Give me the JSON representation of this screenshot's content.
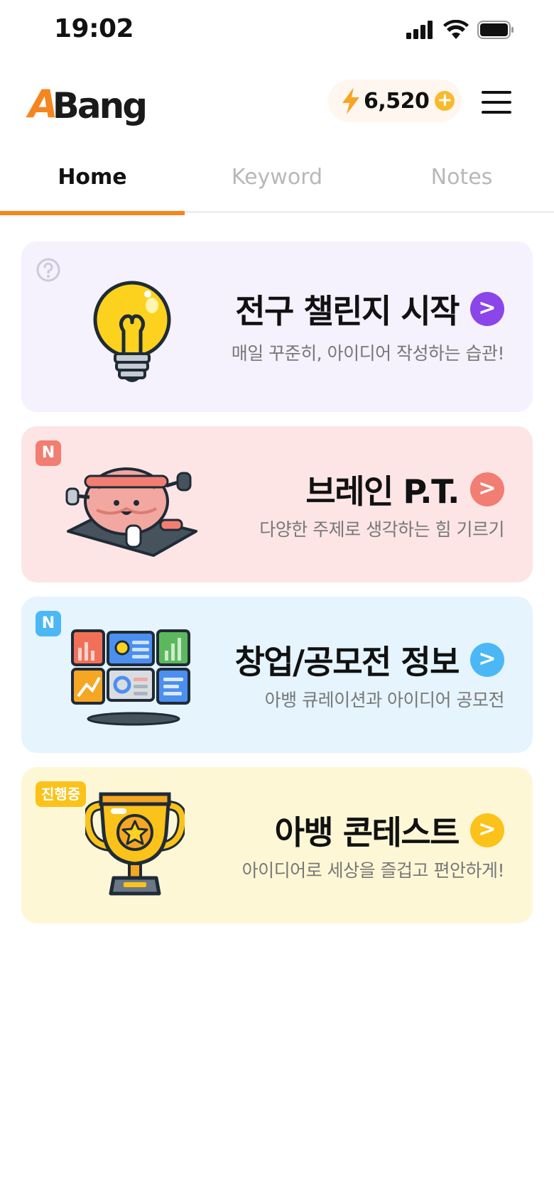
{
  "status_bar": {
    "time": "19:02"
  },
  "header": {
    "logo_first": "A",
    "logo_rest": "Bang",
    "points": "6,520",
    "points_plus": "+"
  },
  "tabs": [
    {
      "label": "Home",
      "active": true
    },
    {
      "label": "Keyword",
      "active": false
    },
    {
      "label": "Notes",
      "active": false
    }
  ],
  "cards": [
    {
      "title": "전구 챌린지 시작",
      "subtitle": "매일 꾸준히, 아이디어 작성하는 습관!",
      "badge": "",
      "accent": "#8b45e8",
      "background": "#f5f1fd",
      "icon": "lightbulb-icon"
    },
    {
      "title": "브레인 P.T.",
      "subtitle": "다양한 주제로 생각하는 힘 기르기",
      "badge": "N",
      "accent": "#f27d72",
      "background": "#fde5e5",
      "icon": "brain-workout-icon"
    },
    {
      "title": "창업/공모전 정보",
      "subtitle": "아뱅 큐레이션과 아이디어 공모전",
      "badge": "N",
      "accent": "#4bb8f5",
      "background": "#e5f4fd",
      "icon": "dashboard-screens-icon"
    },
    {
      "title": "아뱅 콘테스트",
      "subtitle": "아이디어로 세상을 즐겁고 편안하게!",
      "badge": "진행중",
      "accent": "#fbc21a",
      "background": "#fdf7d6",
      "icon": "trophy-icon"
    }
  ],
  "arrow_glyph": ">"
}
